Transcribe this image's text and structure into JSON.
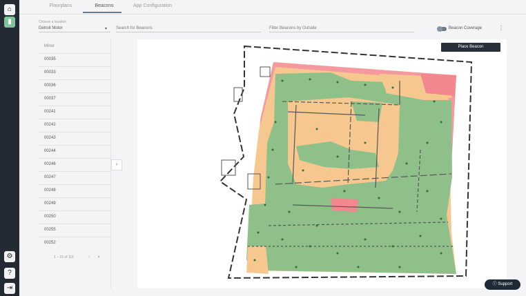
{
  "rail": {
    "items": [
      {
        "icon": "home-icon",
        "glyph": "⌂"
      },
      {
        "icon": "beacon-icon",
        "glyph": "▮"
      },
      {
        "icon": "settings-icon",
        "glyph": "⚙"
      },
      {
        "icon": "help-icon",
        "glyph": "?"
      },
      {
        "icon": "logout-icon",
        "glyph": "⇥"
      }
    ]
  },
  "tabs": [
    "Floorplans",
    "Beacons",
    "App Configuration"
  ],
  "active_tab": "Beacons",
  "filters": {
    "location_label": "Choose a location",
    "location_value": "Detroit Motor",
    "search_placeholder": "Search for Beacons",
    "outside_placeholder": "Filter Beacons by Outside",
    "coverage_label": "Beacon Coverage"
  },
  "list": {
    "header": "Minor",
    "rows": [
      "00035",
      "00033",
      "00036",
      "00037",
      "00241",
      "00242",
      "00243",
      "00244",
      "00246",
      "00247",
      "00248",
      "00249",
      "00250",
      "00255",
      "00252"
    ],
    "pagination": "1 – 15 of 115",
    "prev": "‹",
    "next": "›"
  },
  "map": {
    "place_button": "Place Beacon",
    "colors": {
      "green": "#8fc08a",
      "orange": "#f6c890",
      "red": "#f2878d",
      "wall": "#333333"
    }
  },
  "support_label": "Support",
  "support_icon": "question-icon"
}
